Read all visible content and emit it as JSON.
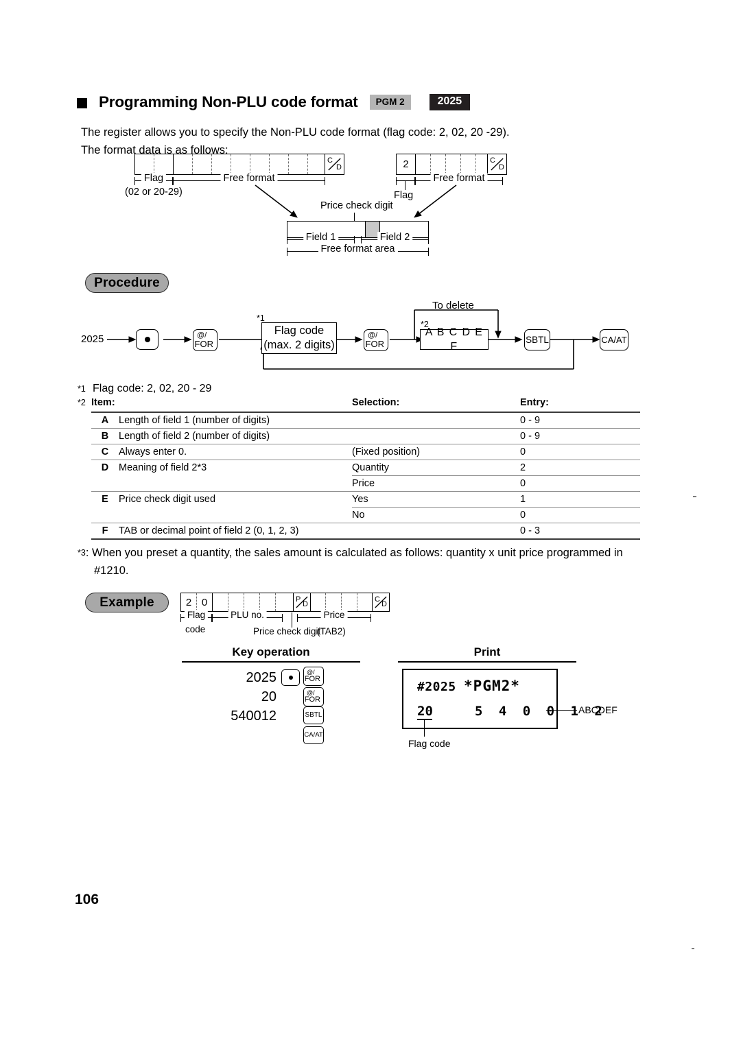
{
  "heading": {
    "title": "Programming Non-PLU code format",
    "badge_mode": "PGM 2",
    "badge_code": "2025"
  },
  "intro": {
    "line1": "The register allows you to specify the Non-PLU code format (flag code: 2, 02, 20 -29).",
    "line2": "The format data is as follows:"
  },
  "format_diagram": {
    "box1": {
      "check_digit_top": "C",
      "check_digit_bottom": "D"
    },
    "box1_labels": {
      "flag": "Flag",
      "flag_sub": "(02 or 20-29)",
      "free_format": "Free format"
    },
    "box2": {
      "flag_value": "2",
      "check_digit_top": "C",
      "check_digit_bottom": "D"
    },
    "box2_labels": {
      "flag": "Flag",
      "free_format": "Free format"
    },
    "field_box": {
      "price_check_digit": "Price check digit",
      "field1": "Field 1",
      "field2": "Field 2",
      "free_format_area": "Free format area"
    }
  },
  "procedure": {
    "pill": "Procedure",
    "start_number": "2025",
    "key_decimal": "•",
    "key_for_top": "@/",
    "key_for_bottom": "FOR",
    "flag_box_line1": "Flag code",
    "flag_box_line2": "(max. 2 digits)",
    "abcdef_box": "A B C D E F",
    "key_sbtl": "SBTL",
    "key_caat": "CA/AT",
    "to_delete": "To delete",
    "note1_marker": "*1",
    "note2_marker": "*2"
  },
  "notes": {
    "note1_marker": "*1",
    "note1_text": "Flag code: 2, 02, 20 - 29",
    "note2_marker": "*2",
    "note3_marker": "*3",
    "note3_line1": ": When you preset a quantity, the sales amount is calculated as follows:  quantity x unit price programmed in",
    "note3_line2": "#1210."
  },
  "table": {
    "headers": {
      "item": "Item:",
      "selection": "Selection:",
      "entry": "Entry:"
    },
    "rows": [
      {
        "letter": "A",
        "desc": "Length of field 1 (number of digits)",
        "sel": "",
        "entry": "0 - 9"
      },
      {
        "letter": "B",
        "desc": "Length of field 2 (number of digits)",
        "sel": "",
        "entry": "0 - 9"
      },
      {
        "letter": "C",
        "desc": "Always enter 0.",
        "sel": "(Fixed position)",
        "entry": "0"
      },
      {
        "letter": "D",
        "desc": "Meaning of field 2*3",
        "sel": "Quantity",
        "entry": "2"
      },
      {
        "letter": "",
        "desc": "",
        "sel": "Price",
        "entry": "0"
      },
      {
        "letter": "E",
        "desc": "Price check digit used",
        "sel": "Yes",
        "entry": "1"
      },
      {
        "letter": "",
        "desc": "",
        "sel": "No",
        "entry": "0"
      },
      {
        "letter": "F",
        "desc": "TAB or decimal point of field 2 (0, 1, 2, 3)",
        "sel": "",
        "entry": "0 - 3"
      }
    ]
  },
  "example": {
    "pill": "Example",
    "cells": {
      "flag_digit1": "2",
      "flag_digit2": "0"
    },
    "pd_top": "P",
    "pd_bottom": "D",
    "cd_top": "C",
    "cd_bottom": "D",
    "labels": {
      "flag": "Flag",
      "code": "code",
      "plu_no": "PLU no.",
      "price_check_digit": "Price check digit",
      "price": "Price",
      "tab2": "(TAB2)"
    }
  },
  "key_operation": {
    "heading": "Key operation",
    "rows": [
      {
        "value": "2025",
        "keys": [
          "dot",
          "for"
        ]
      },
      {
        "value": "20",
        "keys": [
          "for"
        ]
      },
      {
        "value": "540012",
        "keys": [
          "sbtl"
        ]
      },
      {
        "value": "",
        "keys": [
          "caat"
        ]
      }
    ],
    "key_labels": {
      "for_top": "@/",
      "for_bottom": "FOR",
      "sbtl": "SBTL",
      "caat": "CA/AT",
      "dot": "•"
    }
  },
  "print": {
    "heading": "Print",
    "line1_code": "#2025",
    "line1_mode": "*PGM2*",
    "line2_flag": "20",
    "line2_digits": "5 4 0 0 1 2",
    "callout_abcdef": "ABCDEF",
    "callout_flag_code": "Flag code"
  },
  "footer": {
    "page_number": "106"
  },
  "icons": {
    "bullet": "filled-square-icon"
  }
}
